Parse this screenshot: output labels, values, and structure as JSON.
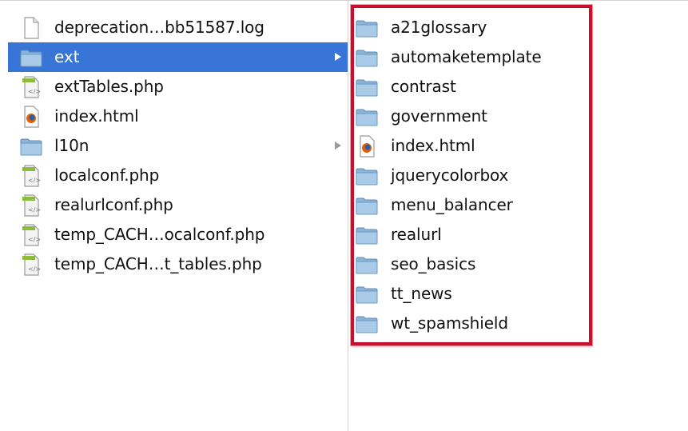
{
  "left_column": {
    "items": [
      {
        "label": "deprecation…bb51587.log",
        "icon": "text-file-icon"
      },
      {
        "label": "ext",
        "icon": "folder-icon",
        "selected": true,
        "has_children": true
      },
      {
        "label": "extTables.php",
        "icon": "php-file-icon"
      },
      {
        "label": "index.html",
        "icon": "html-file-icon"
      },
      {
        "label": "l10n",
        "icon": "folder-icon",
        "has_children": true
      },
      {
        "label": "localconf.php",
        "icon": "php-file-icon"
      },
      {
        "label": "realurlconf.php",
        "icon": "php-file-icon"
      },
      {
        "label": "temp_CACH…ocalconf.php",
        "icon": "php-file-icon"
      },
      {
        "label": "temp_CACH…t_tables.php",
        "icon": "php-file-icon"
      }
    ]
  },
  "right_column": {
    "items": [
      {
        "label": "a21glossary",
        "icon": "folder-icon"
      },
      {
        "label": "automaketemplate",
        "icon": "folder-icon"
      },
      {
        "label": "contrast",
        "icon": "folder-icon"
      },
      {
        "label": "government",
        "icon": "folder-icon"
      },
      {
        "label": "index.html",
        "icon": "html-file-icon"
      },
      {
        "label": "jquerycolorbox",
        "icon": "folder-icon"
      },
      {
        "label": "menu_balancer",
        "icon": "folder-icon"
      },
      {
        "label": "realurl",
        "icon": "folder-icon"
      },
      {
        "label": "seo_basics",
        "icon": "folder-icon"
      },
      {
        "label": "tt_news",
        "icon": "folder-icon"
      },
      {
        "label": "wt_spamshield",
        "icon": "folder-icon"
      }
    ]
  },
  "colors": {
    "selection": "#3875d7",
    "highlight_border": "#c8102e"
  }
}
